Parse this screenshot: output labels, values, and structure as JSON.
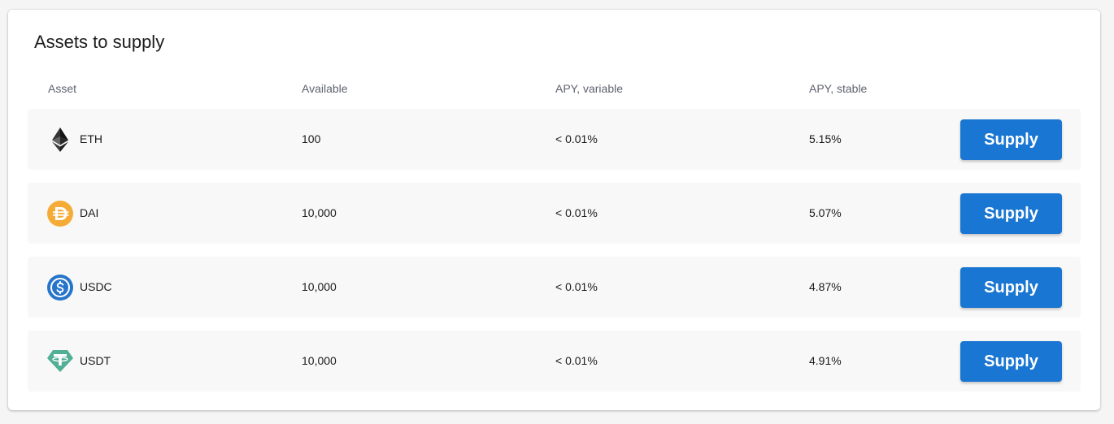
{
  "title": "Assets to supply",
  "columns": {
    "asset": "Asset",
    "available": "Available",
    "apy_variable": "APY, variable",
    "apy_stable": "APY, stable"
  },
  "rows": [
    {
      "symbol": "ETH",
      "icon": "eth-icon",
      "available": "100",
      "apy_variable": "< 0.01%",
      "apy_stable": "5.15%",
      "action": "Supply"
    },
    {
      "symbol": "DAI",
      "icon": "dai-icon",
      "available": "10,000",
      "apy_variable": "< 0.01%",
      "apy_stable": "5.07%",
      "action": "Supply"
    },
    {
      "symbol": "USDC",
      "icon": "usdc-icon",
      "available": "10,000",
      "apy_variable": "< 0.01%",
      "apy_stable": "4.87%",
      "action": "Supply"
    },
    {
      "symbol": "USDT",
      "icon": "usdt-icon",
      "available": "10,000",
      "apy_variable": "< 0.01%",
      "apy_stable": "4.91%",
      "action": "Supply"
    }
  ],
  "colors": {
    "accent": "#1976d2",
    "row_bg": "#f8f8f8",
    "dai": "#f5ac37",
    "usdc": "#2775ca",
    "usdt": "#50af95"
  }
}
